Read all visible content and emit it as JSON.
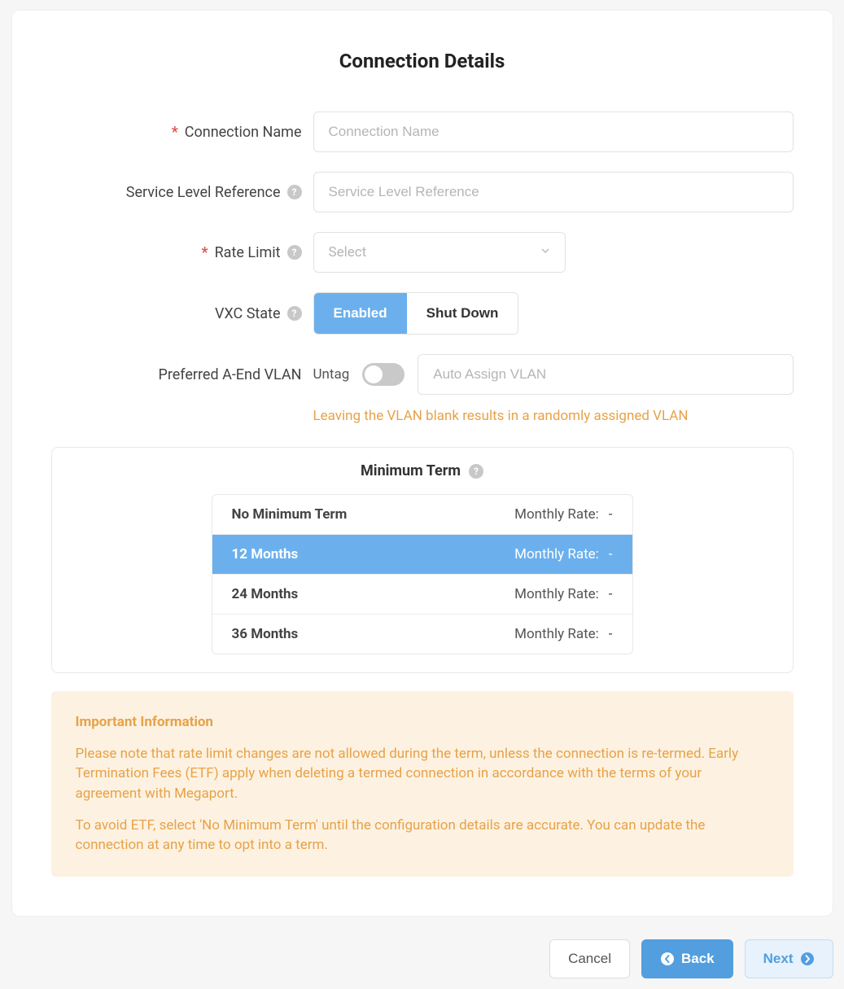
{
  "title": "Connection Details",
  "fields": {
    "connection_name": {
      "label": "Connection Name",
      "required_marker": "*",
      "placeholder": "Connection Name",
      "value": ""
    },
    "service_level_reference": {
      "label": "Service Level Reference",
      "placeholder": "Service Level Reference",
      "value": ""
    },
    "rate_limit": {
      "label": "Rate Limit",
      "required_marker": "*",
      "placeholder": "Select"
    },
    "vxc_state": {
      "label": "VXC State",
      "option_enabled": "Enabled",
      "option_shutdown": "Shut Down"
    },
    "preferred_vlan": {
      "label": "Preferred A-End VLAN",
      "untag_label": "Untag",
      "placeholder": "Auto Assign VLAN",
      "value": "",
      "hint": "Leaving the VLAN blank results in a randomly assigned VLAN"
    }
  },
  "minimum_term": {
    "heading": "Minimum Term",
    "rate_label": "Monthly Rate:",
    "options": [
      {
        "name": "No Minimum Term",
        "rate": "-",
        "selected": false
      },
      {
        "name": "12 Months",
        "rate": "-",
        "selected": true
      },
      {
        "name": "24 Months",
        "rate": "-",
        "selected": false
      },
      {
        "name": "36 Months",
        "rate": "-",
        "selected": false
      }
    ]
  },
  "info": {
    "title": "Important Information",
    "p1": "Please note that rate limit changes are not allowed during the term, unless the connection is re-termed. Early Termination Fees (ETF) apply when deleting a termed connection in accordance with the terms of your agreement with Megaport.",
    "p2": "To avoid ETF, select 'No Minimum Term' until the configuration details are accurate. You can update the connection at any time to opt into a term."
  },
  "footer": {
    "cancel": "Cancel",
    "back": "Back",
    "next": "Next"
  }
}
